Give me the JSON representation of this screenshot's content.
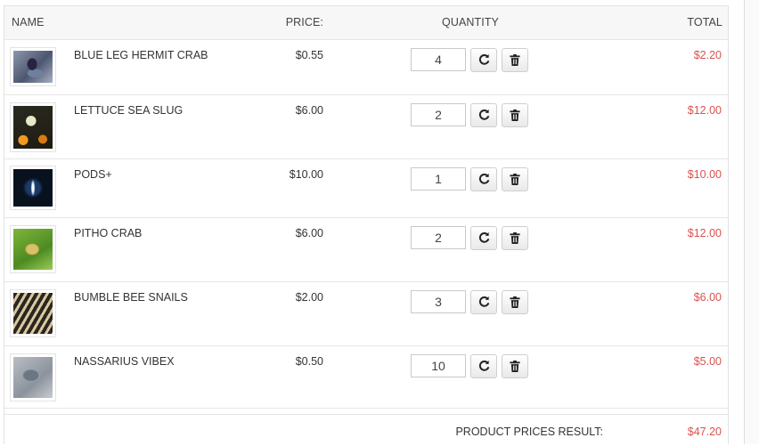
{
  "header": {
    "name": "NAME",
    "price": "PRICE:",
    "quantity": "QUANTITY",
    "total": "TOTAL"
  },
  "items": [
    {
      "name": "BLUE LEG HERMIT CRAB",
      "price": "$0.55",
      "quantity": "4",
      "total": "$2.20",
      "image_icon": "hermit-crab-photo"
    },
    {
      "name": "LETTUCE SEA SLUG",
      "price": "$6.00",
      "quantity": "2",
      "total": "$12.00",
      "image_icon": "sea-slug-photo"
    },
    {
      "name": "PODS+",
      "price": "$10.00",
      "quantity": "1",
      "total": "$10.00",
      "image_icon": "pods-photo"
    },
    {
      "name": "PITHO CRAB",
      "price": "$6.00",
      "quantity": "2",
      "total": "$12.00",
      "image_icon": "pitho-crab-photo"
    },
    {
      "name": "BUMBLE BEE SNAILS",
      "price": "$2.00",
      "quantity": "3",
      "total": "$6.00",
      "image_icon": "bumble-bee-snail-photo"
    },
    {
      "name": "NASSARIUS VIBEX",
      "price": "$0.50",
      "quantity": "10",
      "total": "$5.00",
      "image_icon": "nassarius-snail-photo"
    }
  ],
  "row_actions": {
    "refresh_icon": "refresh-icon",
    "delete_icon": "trash-icon"
  },
  "summary": {
    "label": "PRODUCT PRICES RESULT:",
    "value": "$47.20"
  },
  "colors": {
    "total_text": "#d9534f",
    "header_bg": "#f7f7f7",
    "border": "#e6e6e6"
  }
}
